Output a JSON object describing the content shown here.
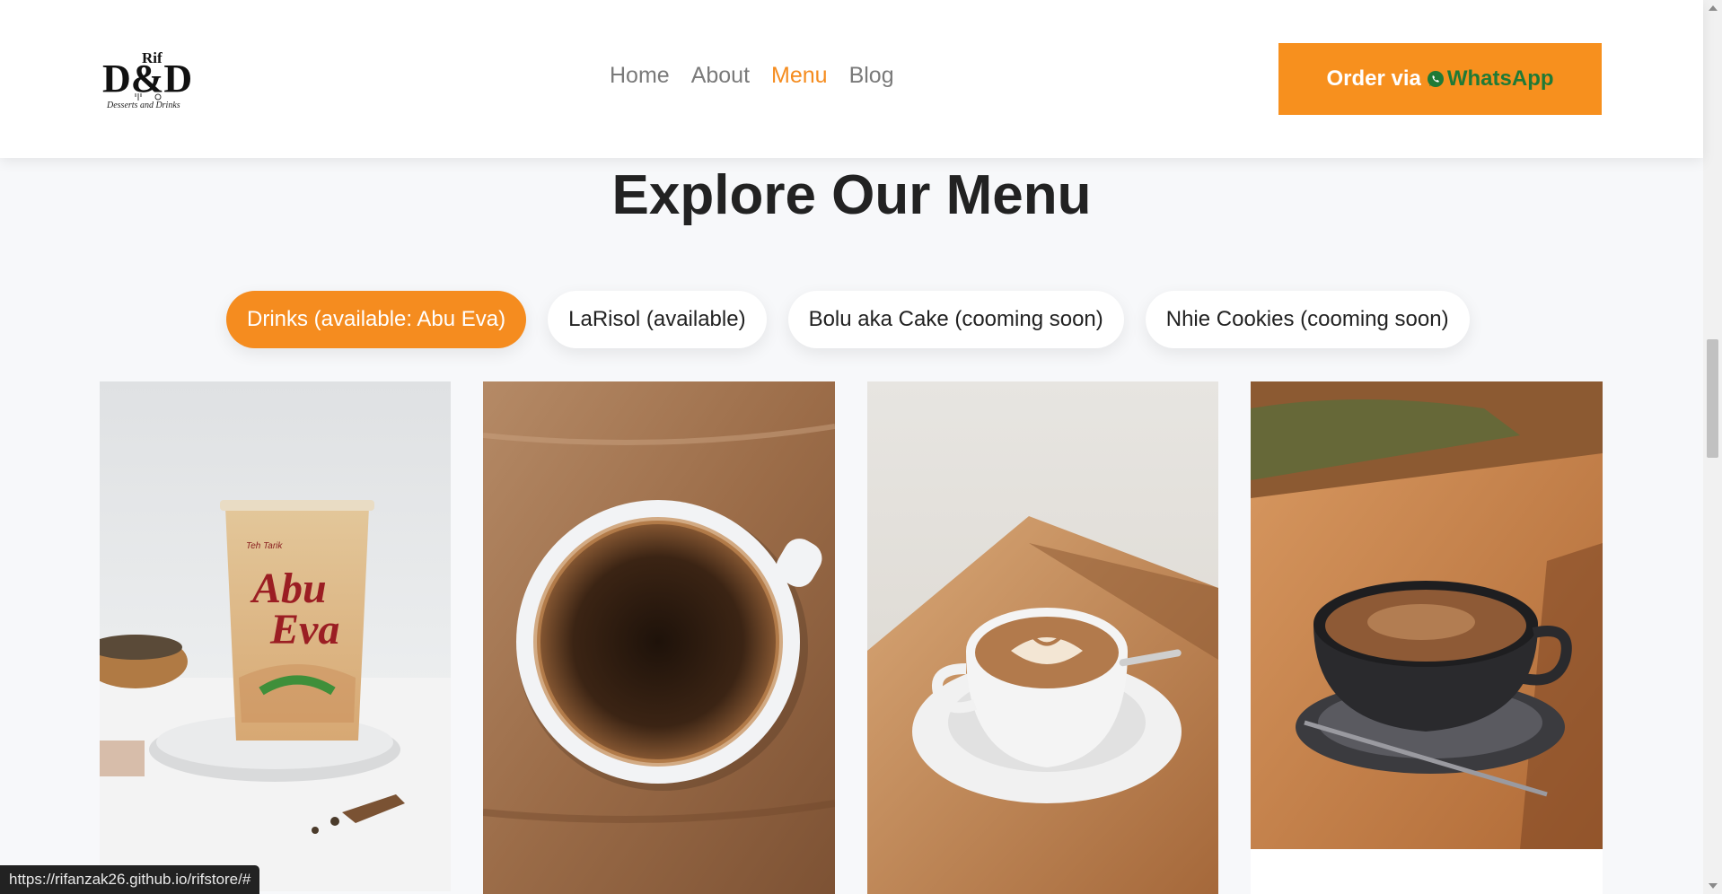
{
  "header": {
    "logo": {
      "brand_top": "Rif",
      "brand_main": "D&D",
      "tagline": "Desserts and Drinks"
    },
    "nav": [
      {
        "label": "Home",
        "active": false
      },
      {
        "label": "About",
        "active": false
      },
      {
        "label": "Menu",
        "active": true
      },
      {
        "label": "Blog",
        "active": false
      }
    ],
    "order": {
      "prefix": "Order via",
      "channel": "WhatsApp",
      "icon": "whatsapp-icon"
    }
  },
  "menu": {
    "title": "Explore Our Menu",
    "filters": [
      {
        "label": "Drinks (available: Abu Eva)",
        "active": true
      },
      {
        "label": "LaRisol (available)",
        "active": false
      },
      {
        "label": "Bolu aka Cake (cooming soon)",
        "active": false
      },
      {
        "label": "Nhie Cookies (cooming soon)",
        "active": false
      }
    ],
    "cards": [
      {
        "image": "abu-eva-teh-tarik-cup"
      },
      {
        "image": "black-coffee-top-view"
      },
      {
        "image": "latte-art-cup"
      },
      {
        "image": "dark-cup-cappuccino"
      }
    ],
    "product_label": {
      "brand_line": "Teh Tarik",
      "name_line_1": "Abu",
      "name_line_2": "Eva"
    }
  },
  "status_bar": {
    "url": "https://rifanzak26.github.io/rifstore/#"
  },
  "colors": {
    "accent": "#f58c1f",
    "whatsapp_text": "#1f7a36",
    "background": "#f7f8fa"
  }
}
